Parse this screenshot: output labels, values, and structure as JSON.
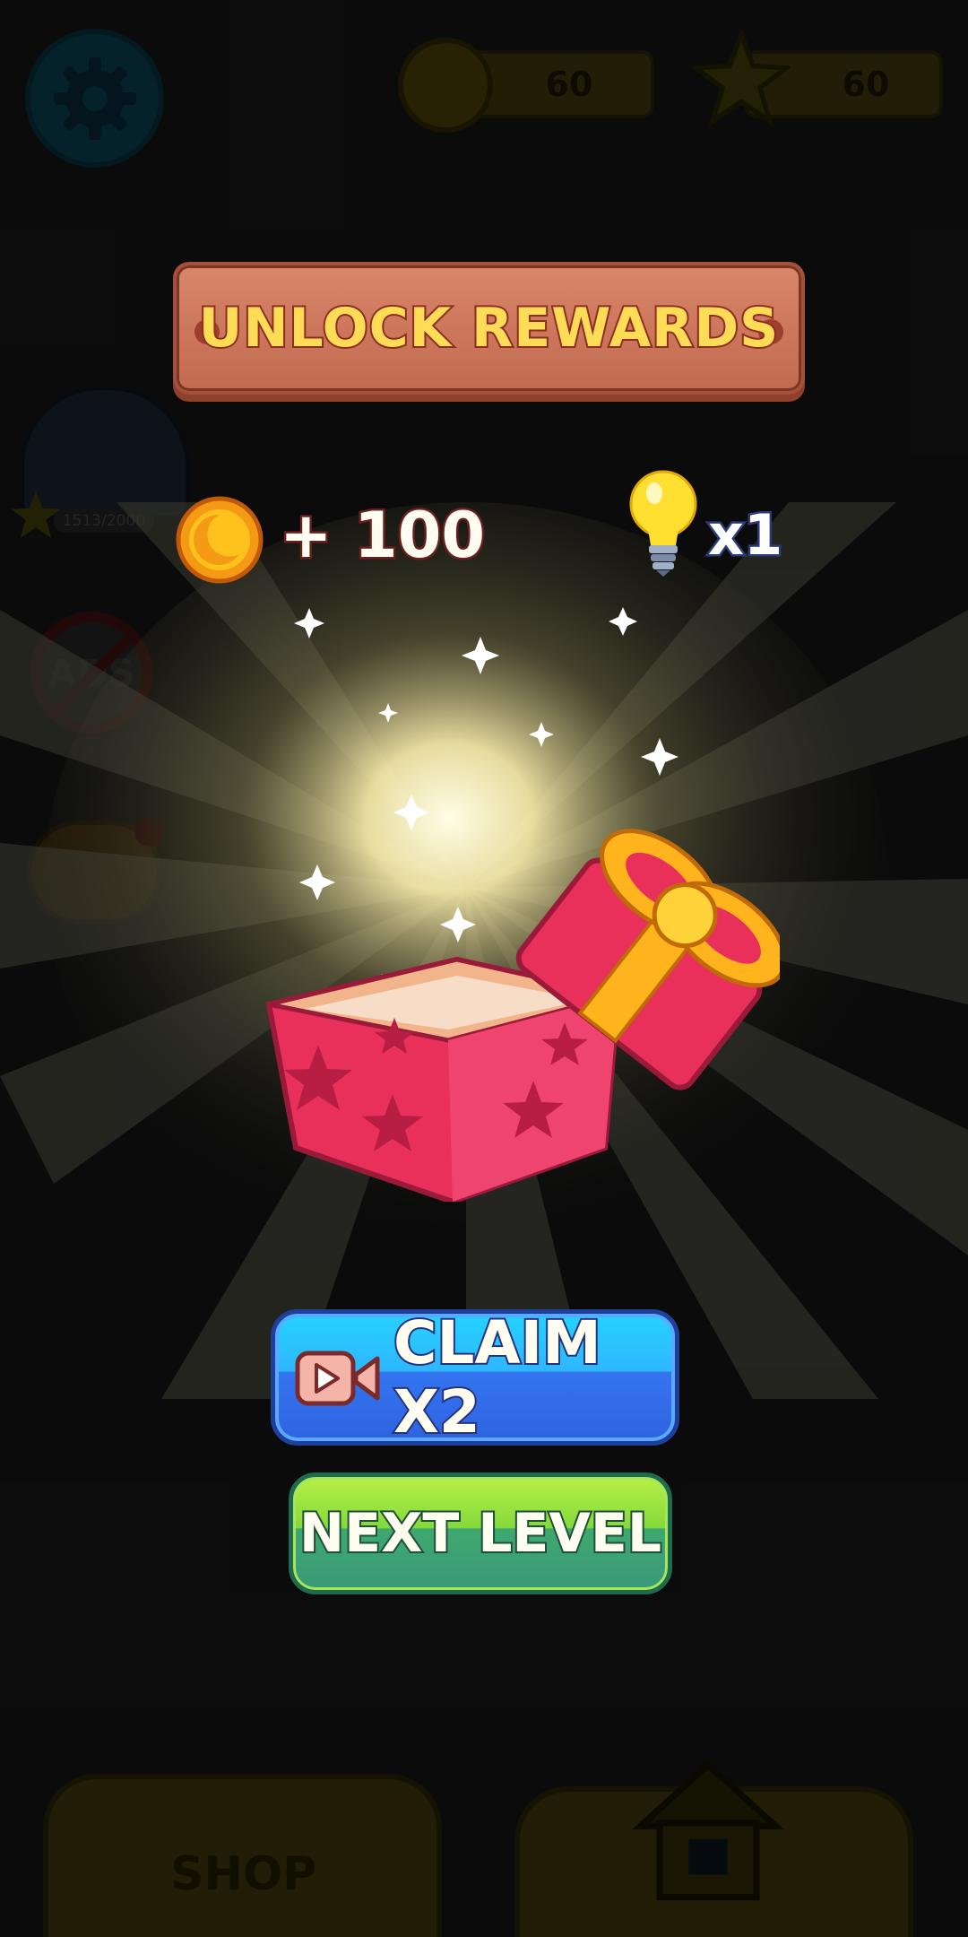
{
  "top_bar": {
    "coins": "60",
    "stars": "60"
  },
  "side": {
    "progress": "1513/2000",
    "noads": "ADS"
  },
  "modal": {
    "title": "UNLOCK REWARDS",
    "reward_coins": "+ 100",
    "reward_hints": "x1",
    "claim_label": "CLAIM X2",
    "next_label": "NEXT LEVEL"
  },
  "bottom_nav": {
    "shop_label": "SHOP"
  },
  "colors": {
    "title_text": "#ffdc55",
    "plank": "#c16a4f",
    "claim_button": "#2fb6ff",
    "next_button": "#84d93c",
    "gift_box": "#e8305a",
    "bow": "#ffb41e"
  },
  "icons": [
    "gear-icon",
    "coin-icon",
    "star-icon",
    "helmet-icon",
    "no-ads-icon",
    "piggy-bank-icon",
    "light-bulb-icon",
    "gift-box-icon",
    "video-camera-icon",
    "shop-icon",
    "home-icon"
  ]
}
